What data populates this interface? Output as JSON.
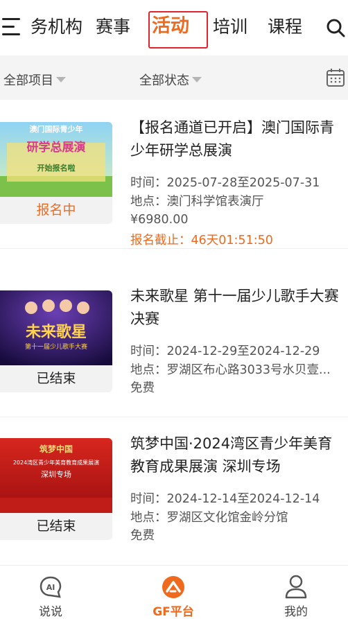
{
  "nav": {
    "tabs": [
      "务机构",
      "赛事",
      "活动",
      "培训",
      "课程"
    ],
    "active_tab": "活动"
  },
  "filters": {
    "project": "全部项目",
    "status": "全部状态"
  },
  "events": [
    {
      "thumb_text_line1": "澳门国际青少年",
      "thumb_text_line2": "研学总展演",
      "thumb_text_line3": "开始报名啦",
      "badge": "报名中",
      "title": "【报名通道已开启】澳门国际青少年研学总展演",
      "time": "时间：2025-07-28至2025-07-31",
      "place": "地点：澳门科学馆表演厅",
      "price": "¥6980.00",
      "deadline": "报名截止：46天01:51:50"
    },
    {
      "thumb_text_line1": "未来歌星",
      "thumb_text_line2": "第十一届少儿歌手大赛",
      "badge": "已结束",
      "title": "未来歌星 第十一届少儿歌手大赛 决赛",
      "time": "时间：2024-12-29至2024-12-29",
      "place": "地点：罗湖区布心路3033号水贝壹...",
      "price": "免费"
    },
    {
      "thumb_text_line1": "筑梦中国",
      "thumb_text_line2": "2024湾区青少年美育教育成果展演",
      "thumb_text_line3": "深圳专场",
      "badge": "已结束",
      "title": "筑梦中国·2024湾区青少年美育教育成果展演 深圳专场",
      "time": "时间：2024-12-14至2024-12-14",
      "place": "地点：罗湖区文化馆金岭分馆",
      "price": "免费"
    }
  ],
  "bottom_nav": [
    {
      "label": "说说",
      "icon": "ai-chat-icon"
    },
    {
      "label": "GF平台",
      "icon": "gf-platform-icon"
    },
    {
      "label": "我的",
      "icon": "user-profile-icon"
    }
  ],
  "colors": {
    "accent": "#f06a1e",
    "highlight_box": "#e0232d",
    "filter_bg": "#f4f4f5"
  }
}
